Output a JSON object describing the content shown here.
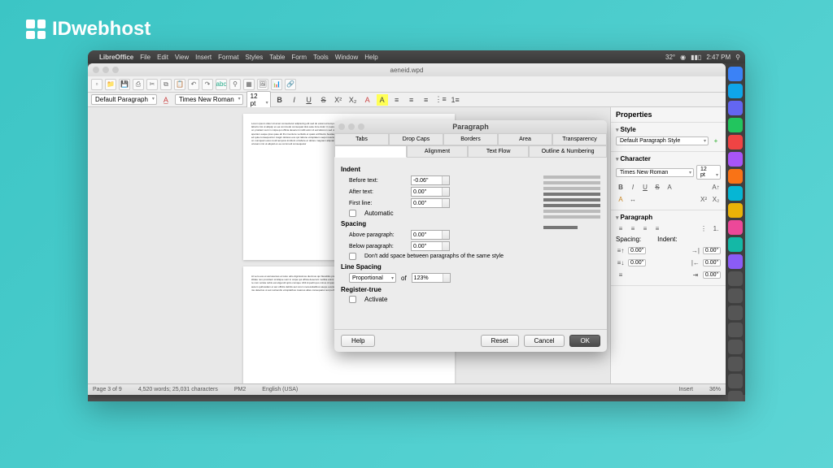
{
  "logo_text": "IDwebhost",
  "menubar": {
    "app": "LibreOffice",
    "items": [
      "File",
      "Edit",
      "View",
      "Insert",
      "Format",
      "Styles",
      "Table",
      "Form",
      "Tools",
      "Window",
      "Help"
    ],
    "right_temp": "32°",
    "right_time": "2:47 PM"
  },
  "window": {
    "title": "aeneid.wpd",
    "style_combo": "Default Paragraph",
    "font_combo": "Times New Roman",
    "size_combo": "12 pt"
  },
  "props": {
    "header": "Properties",
    "style_sec": "Style",
    "style_val": "Default Paragraph Style",
    "char_sec": "Character",
    "char_font": "Times New Roman",
    "char_size": "12 pt",
    "para_sec": "Paragraph",
    "spacing_lbl": "Spacing:",
    "indent_lbl": "Indent:",
    "zero": "0.00\""
  },
  "status": {
    "page": "Page 3 of 9",
    "words": "4,520 words; 25,031 characters",
    "pm": "PM2",
    "lang": "English (USA)",
    "insert": "Insert",
    "zoom": "36%"
  },
  "dialog": {
    "title": "Paragraph",
    "tabs1": [
      "Tabs",
      "Drop Caps",
      "Borders",
      "Area",
      "Transparency"
    ],
    "tabs2": [
      "",
      "Alignment",
      "Text Flow",
      "Outline & Numbering"
    ],
    "indent_hdr": "Indent",
    "before_text": "Before text:",
    "before_val": "-0.06\"",
    "after_text": "After text:",
    "after_val": "0.00\"",
    "first_line": "First line:",
    "first_val": "0.00\"",
    "automatic": "Automatic",
    "spacing_hdr": "Spacing",
    "above_para": "Above paragraph:",
    "above_val": "0.00\"",
    "below_para": "Below paragraph:",
    "below_val": "0.00\"",
    "dont_add": "Don't add space between paragraphs of the same style",
    "line_spacing_hdr": "Line Spacing",
    "ls_type": "Proportional",
    "ls_of": "of",
    "ls_val": "123%",
    "register_hdr": "Register-true",
    "activate": "Activate",
    "help": "Help",
    "reset": "Reset",
    "cancel": "Cancel",
    "ok": "OK"
  },
  "dock_colors": [
    "#3b82f6",
    "#0ea5e9",
    "#6366f1",
    "#22c55e",
    "#ef4444",
    "#a855f7",
    "#f97316",
    "#06b6d4",
    "#eab308",
    "#ec4899",
    "#14b8a6",
    "#8b5cf6",
    "#555",
    "#555",
    "#555",
    "#555",
    "#555",
    "#555",
    "#555",
    "#555"
  ]
}
